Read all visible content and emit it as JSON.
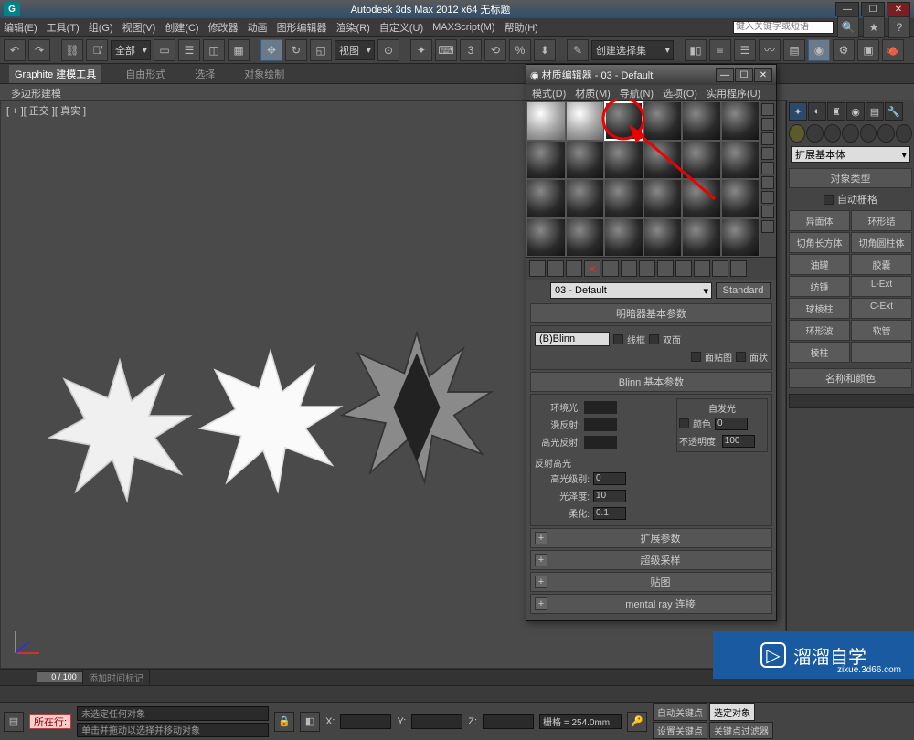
{
  "title": "Autodesk 3ds Max 2012 x64   无标题",
  "menus": [
    "编辑(E)",
    "工具(T)",
    "组(G)",
    "视图(V)",
    "创建(C)",
    "修改器",
    "动画",
    "图形编辑器",
    "渲染(R)",
    "自定义(U)",
    "MAXScript(M)",
    "帮助(H)"
  ],
  "help_placeholder": "键入关键字或短语",
  "toolbar_dropdown1": "全部",
  "toolbar_dropdown2": "视图",
  "toolbar_dropdown3": "创建选择集",
  "ribbon": {
    "tabs": [
      "Graphite 建模工具",
      "自由形式",
      "选择",
      "对象绘制"
    ],
    "active": 0,
    "sub": "多边形建模"
  },
  "viewport_label": "[ + ][ 正交 ][ 真实 ]",
  "time_slider": "0 / 100",
  "status": {
    "line1": "未选定任何对象",
    "line2": "单击并拖动以选择并移动对象",
    "grid": "栅格 = 254.0mm",
    "autokey": "自动关键点",
    "selected": "选定对象",
    "setkey": "设置关键点",
    "keyfilter": "关键点过滤器",
    "add_time": "添加时间标记",
    "x": "X:",
    "y": "Y:",
    "z": "Z:",
    "row_label": "所在行:"
  },
  "cmd": {
    "dropdown": "扩展基本体",
    "section1": "对象类型",
    "autogrid": "自动栅格",
    "objects": [
      "异面体",
      "环形结",
      "切角长方体",
      "切角圆柱体",
      "油罐",
      "胶囊",
      "纺锤",
      "L-Ext",
      "球棱柱",
      "C-Ext",
      "环形波",
      "软管",
      "棱柱",
      ""
    ],
    "section2": "名称和颜色"
  },
  "material_editor": {
    "title": "材质编辑器 - 03 - Default",
    "menus": [
      "模式(D)",
      "材质(M)",
      "导航(N)",
      "选项(O)",
      "实用程序(U)"
    ],
    "name": "03 - Default",
    "type_btn": "Standard",
    "shader_section": "明暗器基本参数",
    "shader": "(B)Blinn",
    "checks": {
      "wire": "线框",
      "two": "双面",
      "facemap": "面贴图",
      "faceted": "面状"
    },
    "blinn_section": "Blinn 基本参数",
    "selfillum": "自发光",
    "color_lbl": "颜色",
    "ambient": "环境光:",
    "diffuse": "漫反射:",
    "specular": "高光反射:",
    "opacity": "不透明度:",
    "opacity_val": "100",
    "spec_hdr": "反射高光",
    "spec_level": "高光级别:",
    "spec_level_val": "0",
    "gloss": "光泽度:",
    "gloss_val": "10",
    "soften": "柔化:",
    "soften_val": "0.1",
    "rollouts": [
      "扩展参数",
      "超级采样",
      "贴图",
      "mental ray 连接"
    ]
  },
  "watermark": {
    "brand": "溜溜自学",
    "url": "zixue.3d66.com"
  }
}
